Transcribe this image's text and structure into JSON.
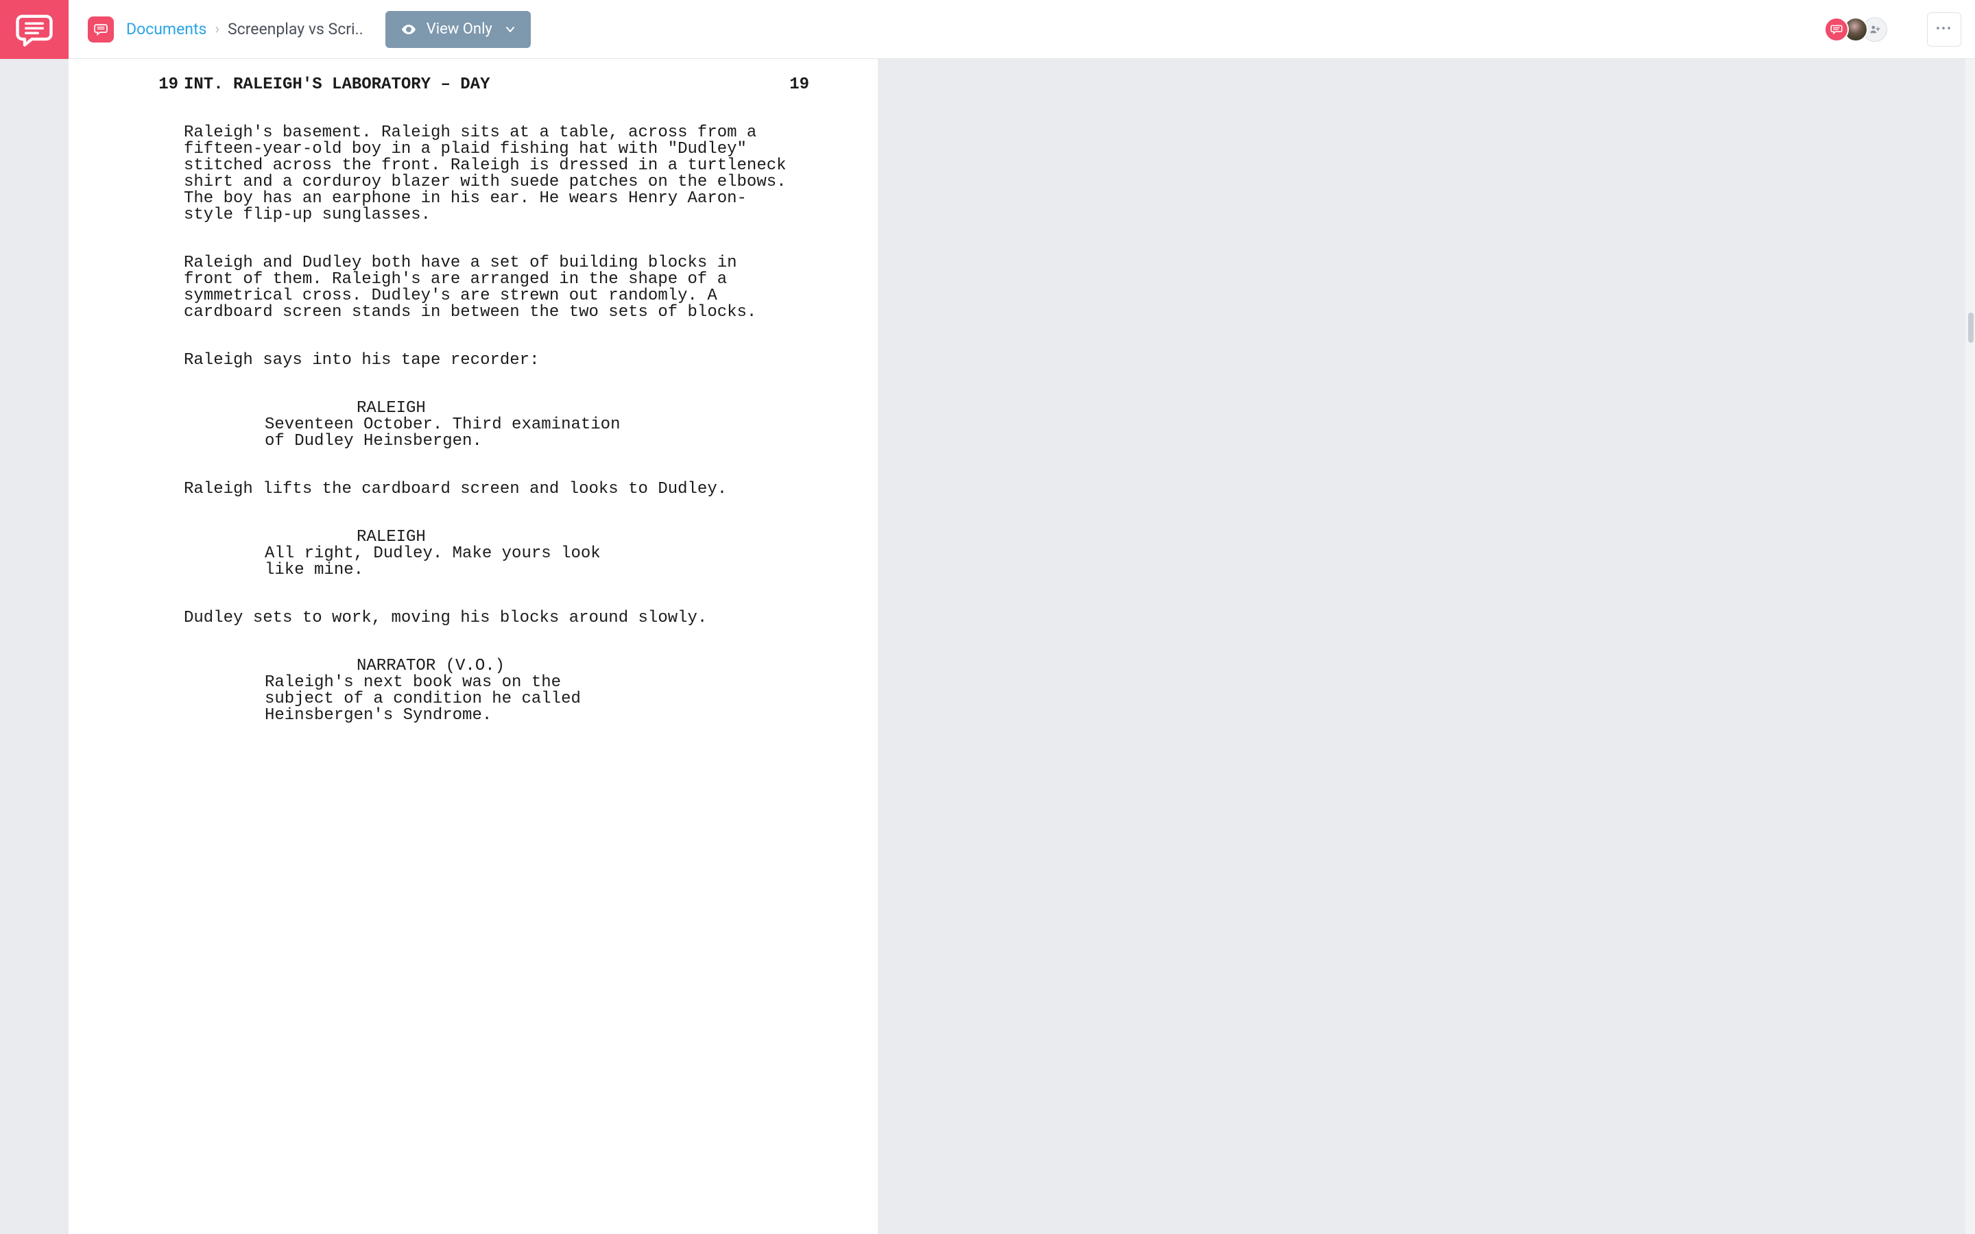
{
  "header": {
    "breadcrumb_root": "Documents",
    "breadcrumb_current": "Screenplay vs Scri..",
    "view_mode_label": "View Only"
  },
  "more_glyph": "•••",
  "screenplay": {
    "scene_number": "19",
    "scene_heading": "INT. RALEIGH'S LABORATORY – DAY",
    "blocks": [
      {
        "type": "action",
        "text": "Raleigh's basement. Raleigh sits at a table, across from a fifteen-year-old boy in a plaid fishing hat with \"Dudley\" stitched across the front. Raleigh is dressed in a turtleneck shirt and a corduroy blazer with suede patches on the elbows. The boy has an earphone in his ear. He wears Henry Aaron-style flip-up sunglasses."
      },
      {
        "type": "action",
        "text": "Raleigh and Dudley both have a set of building blocks in front of them. Raleigh's are arranged in the shape of a symmetrical cross. Dudley's are strewn out randomly. A cardboard screen stands in between the two sets of blocks."
      },
      {
        "type": "action",
        "text": "Raleigh says into his tape recorder:"
      },
      {
        "type": "character",
        "text": "RALEIGH"
      },
      {
        "type": "dialogue",
        "text": "Seventeen October. Third examination of Dudley Heinsbergen."
      },
      {
        "type": "action",
        "text": "Raleigh lifts the cardboard screen and looks to Dudley."
      },
      {
        "type": "character",
        "text": "RALEIGH"
      },
      {
        "type": "dialogue",
        "text": "All right, Dudley. Make yours look like mine."
      },
      {
        "type": "action",
        "text": "Dudley sets to work, moving his blocks around slowly."
      },
      {
        "type": "character",
        "text": "NARRATOR (V.O.)"
      },
      {
        "type": "dialogue",
        "text": "Raleigh's next book was on the subject of a condition he called Heinsbergen's Syndrome."
      }
    ]
  }
}
